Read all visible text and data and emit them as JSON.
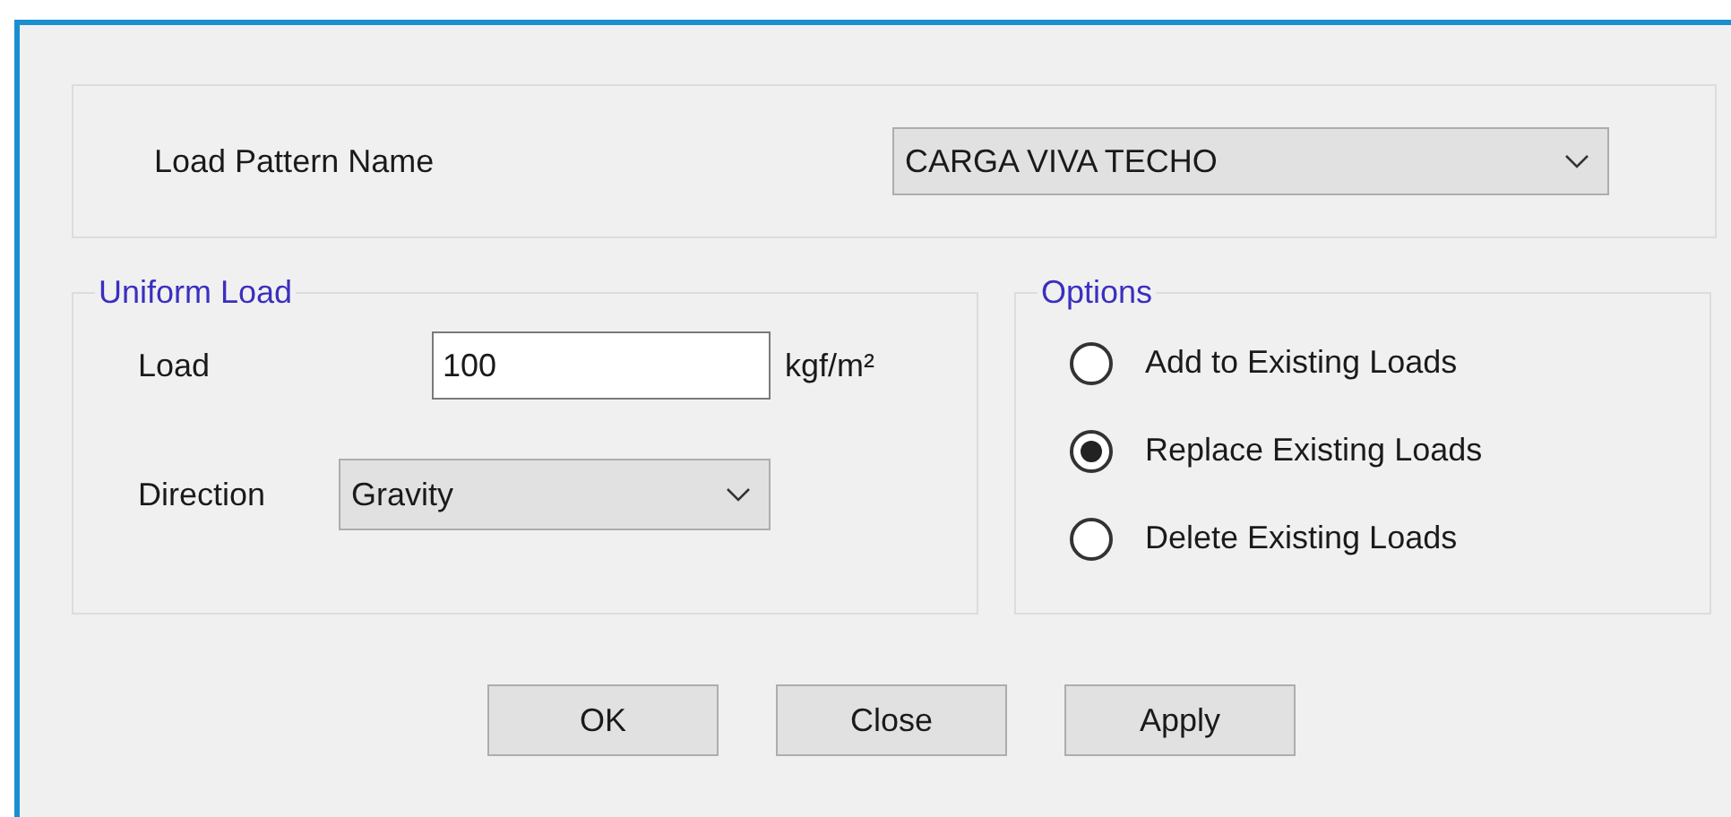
{
  "load_pattern": {
    "label": "Load Pattern Name",
    "value": "CARGA VIVA TECHO"
  },
  "uniform_load": {
    "title": "Uniform Load",
    "load_label": "Load",
    "load_value": "100",
    "unit": "kgf/m²",
    "direction_label": "Direction",
    "direction_value": "Gravity"
  },
  "options": {
    "title": "Options",
    "items": [
      {
        "label": "Add to Existing Loads",
        "selected": false
      },
      {
        "label": "Replace Existing Loads",
        "selected": true
      },
      {
        "label": "Delete Existing Loads",
        "selected": false
      }
    ]
  },
  "buttons": [
    "OK",
    "Close",
    "Apply"
  ]
}
